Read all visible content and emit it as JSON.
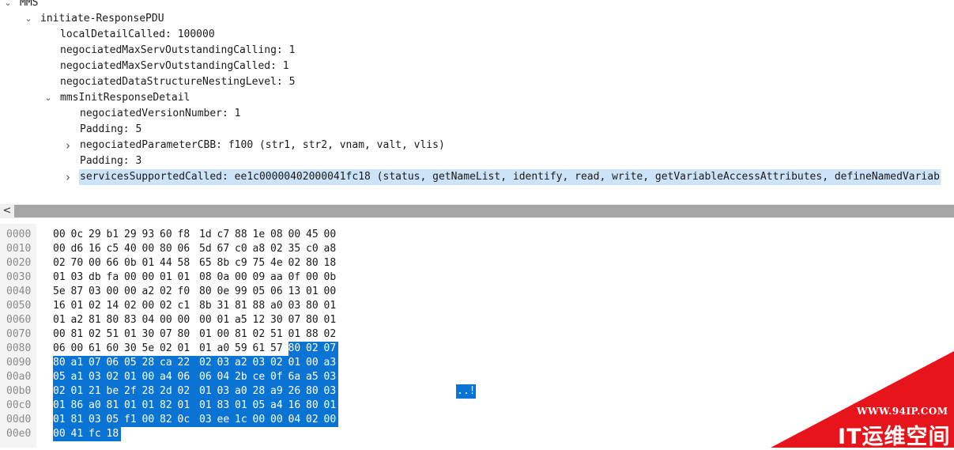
{
  "details": {
    "rows": [
      {
        "label": "MMS",
        "arrow": "down"
      },
      {
        "label": "initiate-ResponsePDU",
        "arrow": "down"
      },
      {
        "label": "localDetailCalled: 100000",
        "arrow": ""
      },
      {
        "label": "negociatedMaxServOutstandingCalling: 1",
        "arrow": ""
      },
      {
        "label": "negociatedMaxServOutstandingCalled: 1",
        "arrow": ""
      },
      {
        "label": "negociatedDataStructureNestingLevel: 5",
        "arrow": ""
      },
      {
        "label": "mmsInitResponseDetail",
        "arrow": "down"
      },
      {
        "label": "negociatedVersionNumber: 1",
        "arrow": ""
      },
      {
        "label": "Padding: 5",
        "arrow": ""
      },
      {
        "label": "negociatedParameterCBB: f100 (str1, str2, vnam, valt, vlis)",
        "arrow": "right"
      },
      {
        "label": "Padding: 3",
        "arrow": ""
      },
      {
        "label": "servicesSupportedCalled: ee1c00000402000041fc18 (status, getNameList, identify, read, write, getVariableAccessAttributes, defineNamedVariab",
        "arrow": "right",
        "selected": true
      }
    ]
  },
  "scrollbar": {
    "left_arrow": "<"
  },
  "hex": {
    "highlight_color": "#0a74d4",
    "rows": [
      {
        "offset": "0000",
        "bytes": [
          "00",
          "0c",
          "29",
          "b1",
          "29",
          "93",
          "60",
          "f8",
          "1d",
          "c7",
          "88",
          "1e",
          "08",
          "00",
          "45",
          "00"
        ]
      },
      {
        "offset": "0010",
        "bytes": [
          "00",
          "d6",
          "16",
          "c5",
          "40",
          "00",
          "80",
          "06",
          "5d",
          "67",
          "c0",
          "a8",
          "02",
          "35",
          "c0",
          "a8"
        ]
      },
      {
        "offset": "0020",
        "bytes": [
          "02",
          "70",
          "00",
          "66",
          "0b",
          "01",
          "44",
          "58",
          "65",
          "8b",
          "c9",
          "75",
          "4e",
          "02",
          "80",
          "18"
        ]
      },
      {
        "offset": "0030",
        "bytes": [
          "01",
          "03",
          "db",
          "fa",
          "00",
          "00",
          "01",
          "01",
          "08",
          "0a",
          "00",
          "09",
          "aa",
          "0f",
          "00",
          "0b"
        ]
      },
      {
        "offset": "0040",
        "bytes": [
          "5e",
          "87",
          "03",
          "00",
          "00",
          "a2",
          "02",
          "f0",
          "80",
          "0e",
          "99",
          "05",
          "06",
          "13",
          "01",
          "00"
        ]
      },
      {
        "offset": "0050",
        "bytes": [
          "16",
          "01",
          "02",
          "14",
          "02",
          "00",
          "02",
          "c1",
          "8b",
          "31",
          "81",
          "88",
          "a0",
          "03",
          "80",
          "01"
        ]
      },
      {
        "offset": "0060",
        "bytes": [
          "01",
          "a2",
          "81",
          "80",
          "83",
          "04",
          "00",
          "00",
          "00",
          "01",
          "a5",
          "12",
          "30",
          "07",
          "80",
          "01"
        ]
      },
      {
        "offset": "0070",
        "bytes": [
          "00",
          "81",
          "02",
          "51",
          "01",
          "30",
          "07",
          "80",
          "01",
          "00",
          "81",
          "02",
          "51",
          "01",
          "88",
          "02"
        ]
      },
      {
        "offset": "0080",
        "bytes": [
          "06",
          "00",
          "61",
          "60",
          "30",
          "5e",
          "02",
          "01",
          "01",
          "a0",
          "59",
          "61",
          "57",
          "80",
          "02",
          "07"
        ],
        "hl_from": 13
      },
      {
        "offset": "0090",
        "bytes": [
          "80",
          "a1",
          "07",
          "06",
          "05",
          "28",
          "ca",
          "22",
          "02",
          "03",
          "a2",
          "03",
          "02",
          "01",
          "00",
          "a3"
        ],
        "hl_from": 0
      },
      {
        "offset": "00a0",
        "bytes": [
          "05",
          "a1",
          "03",
          "02",
          "01",
          "00",
          "a4",
          "06",
          "06",
          "04",
          "2b",
          "ce",
          "0f",
          "6a",
          "a5",
          "03"
        ],
        "hl_from": 0
      },
      {
        "offset": "00b0",
        "bytes": [
          "02",
          "01",
          "21",
          "be",
          "2f",
          "28",
          "2d",
          "02",
          "01",
          "03",
          "a0",
          "28",
          "a9",
          "26",
          "80",
          "03"
        ],
        "hl_from": 0,
        "ascii": "..!"
      },
      {
        "offset": "00c0",
        "bytes": [
          "01",
          "86",
          "a0",
          "81",
          "01",
          "01",
          "82",
          "01",
          "01",
          "83",
          "01",
          "05",
          "a4",
          "16",
          "80",
          "01"
        ],
        "hl_from": 0
      },
      {
        "offset": "00d0",
        "bytes": [
          "01",
          "81",
          "03",
          "05",
          "f1",
          "00",
          "82",
          "0c",
          "03",
          "ee",
          "1c",
          "00",
          "00",
          "04",
          "02",
          "00"
        ],
        "hl_from": 0
      },
      {
        "offset": "00e0",
        "bytes": [
          "00",
          "41",
          "fc",
          "18"
        ],
        "hl_from": 0
      }
    ]
  },
  "watermark": {
    "url": "WWW.94IP.COM",
    "name": "IT运维空间",
    "color": "#e8141c"
  }
}
